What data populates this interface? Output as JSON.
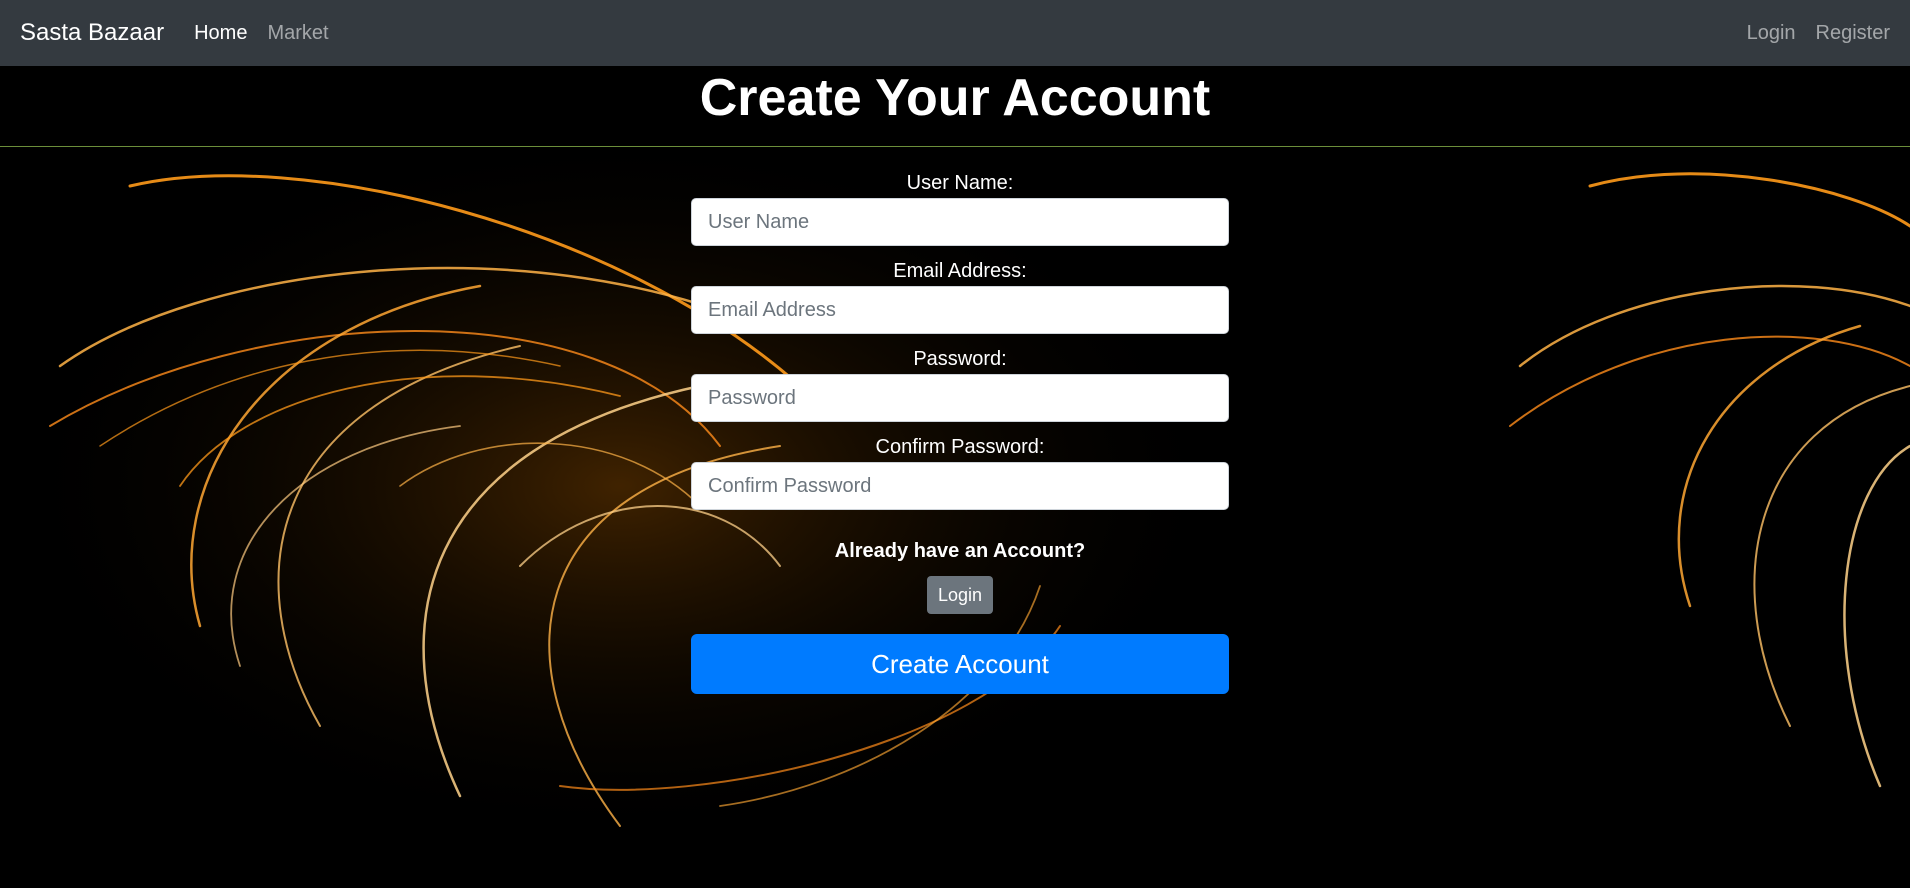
{
  "navbar": {
    "brand": "Sasta Bazaar",
    "links_left": [
      {
        "label": "Home",
        "active": true
      },
      {
        "label": "Market",
        "active": false
      }
    ],
    "links_right": [
      {
        "label": "Login"
      },
      {
        "label": "Register"
      }
    ]
  },
  "page": {
    "title": "Create Your Account"
  },
  "form": {
    "username": {
      "label": "User Name:",
      "placeholder": "User Name",
      "value": ""
    },
    "email": {
      "label": "Email Address:",
      "placeholder": "Email Address",
      "value": ""
    },
    "password": {
      "label": "Password:",
      "placeholder": "Password",
      "value": ""
    },
    "confirm_password": {
      "label": "Confirm Password:",
      "placeholder": "Confirm Password",
      "value": ""
    },
    "already_text": "Already have an Account?",
    "login_button": "Login",
    "submit_button": "Create Account"
  },
  "colors": {
    "navbar_bg": "#343a40",
    "primary": "#007bff",
    "secondary": "#6c757d",
    "background": "#000000",
    "swirl_accent": "#ff9a1a"
  }
}
